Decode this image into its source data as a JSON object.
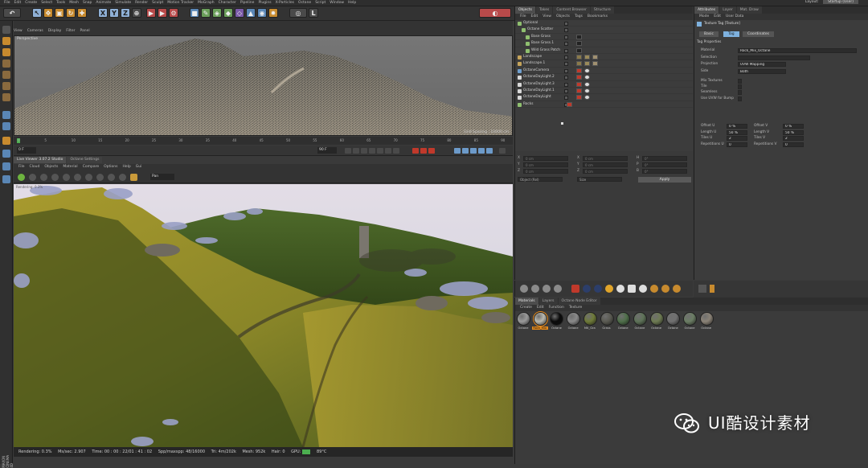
{
  "menubar": {
    "items": [
      "File",
      "Edit",
      "Create",
      "Select",
      "Tools",
      "Mesh",
      "Snap",
      "Animate",
      "Simulate",
      "Render",
      "Sculpt",
      "Motion Tracker",
      "MoGraph",
      "Character",
      "Pipeline",
      "Plugins",
      "X-Particles",
      "Octane",
      "Script",
      "Window",
      "Help"
    ],
    "layout_label": "Layout:",
    "layout_value": "Startup (User)"
  },
  "viewport1": {
    "tabs": [
      "View",
      "Cameras",
      "Display",
      "Filter",
      "Panel"
    ],
    "name": "Perspective",
    "grid_spacing": "Grid Spacing : 10000 cm"
  },
  "timeline": {
    "ticks": [
      "0",
      "5",
      "10",
      "15",
      "20",
      "25",
      "30",
      "35",
      "40",
      "45",
      "50",
      "55",
      "60",
      "65",
      "70",
      "75",
      "80",
      "85",
      "90"
    ],
    "start": "0 F",
    "end": "90 F"
  },
  "viewport2": {
    "tabs": [
      "Live Viewer 3.07.2 Studio",
      "Octane Settings"
    ],
    "menu": [
      "File",
      "Cloud",
      "Objects",
      "Material",
      "Compare",
      "Options",
      "Help",
      "Gui"
    ],
    "zoom": "Pan",
    "render_label": "Rendering: 0.3%"
  },
  "status": {
    "rendering": "Rendering: 0.3%",
    "ms_sec": "Ms/sec: 2.907",
    "time": "Time: 00 : 00 : 22/01 : 41 : 02",
    "spp": "Spp/maxspp: 48/16000",
    "tri": "Tri: 4m/202k",
    "mesh": "Mesh: 952k",
    "hair": "Hair: 0",
    "gpu": "GPU:",
    "temp": "89°C"
  },
  "object_manager": {
    "tabs": [
      "Objects",
      "Takes",
      "Content Browser",
      "Structure"
    ],
    "menu": [
      "File",
      "Edit",
      "View",
      "Objects",
      "Tags",
      "Bookmarks"
    ],
    "objects": [
      {
        "name": "Optional",
        "indent": 0,
        "color": "#8fbf6f"
      },
      {
        "name": "Octane Scatter",
        "indent": 1,
        "color": "#8fbf6f"
      },
      {
        "name": "Base Grass",
        "indent": 2,
        "color": "#8fbf6f"
      },
      {
        "name": "Base Grass.1",
        "indent": 2,
        "color": "#8fbf6f"
      },
      {
        "name": "Wild Grass Patch",
        "indent": 2,
        "color": "#8fbf6f"
      },
      {
        "name": "Landscape",
        "indent": 0,
        "color": "#c4a35a"
      },
      {
        "name": "Landscape.1",
        "indent": 0,
        "color": "#c4a35a"
      },
      {
        "name": "OctaneCamera",
        "indent": 0,
        "color": "#6fa0cf"
      },
      {
        "name": "OctaneDayLight.2",
        "indent": 0,
        "color": "#d8d8d8"
      },
      {
        "name": "OctaneDayLight.3",
        "indent": 0,
        "color": "#d8d8d8"
      },
      {
        "name": "OctaneDayLight.1",
        "indent": 0,
        "color": "#d8d8d8"
      },
      {
        "name": "OctaneDayLight",
        "indent": 0,
        "color": "#d8d8d8"
      },
      {
        "name": "Rocks",
        "indent": 0,
        "color": "#8fbf6f"
      }
    ]
  },
  "coordinates": {
    "rows": [
      [
        "X",
        "0 cm",
        "X",
        "0 cm",
        "H",
        "0°"
      ],
      [
        "Y",
        "0 cm",
        "Y",
        "0 cm",
        "P",
        "0°"
      ],
      [
        "Z",
        "0 cm",
        "Z",
        "0 cm",
        "B",
        "0°"
      ]
    ],
    "mode1": "Object (Rel)",
    "mode2": "Size",
    "apply": "Apply"
  },
  "material_manager": {
    "tabs": [
      "Materials",
      "Layers",
      "Octane Node Editor"
    ],
    "menu": [
      "Create",
      "Edit",
      "Function",
      "Texture"
    ],
    "materials": [
      {
        "name": "Octane",
        "color": "#9a9a9a"
      },
      {
        "name": "Rock_Mix",
        "color": "#b9b9b0"
      },
      {
        "name": "Octane",
        "color": "#0a0a0a"
      },
      {
        "name": "Octane",
        "color": "#8a8a8a"
      },
      {
        "name": "Mtl_Gra",
        "color": "#6e7a38"
      },
      {
        "name": "Grass",
        "color": "#5a5a52"
      },
      {
        "name": "Octane",
        "color": "#4f6f4a"
      },
      {
        "name": "Octane",
        "color": "#5e7258"
      },
      {
        "name": "Octane",
        "color": "#6d7a52"
      },
      {
        "name": "Octane",
        "color": "#707070"
      },
      {
        "name": "Octane",
        "color": "#6b7d64"
      },
      {
        "name": "Octane",
        "color": "#8a8276"
      }
    ]
  },
  "attributes": {
    "tabs": [
      "Attributes",
      "Layer",
      "Mat. Draw"
    ],
    "menu": [
      "Mode",
      "Edit",
      "User Data"
    ],
    "title": "Texture Tag [Texture]",
    "buttons": [
      "Basic",
      "Tag",
      "Coordinates"
    ],
    "section": "Tag Properties",
    "rows": [
      {
        "label": "Material",
        "value": "Rock_Mix_Octane"
      },
      {
        "label": "Selection",
        "value": ""
      },
      {
        "label": "Projection",
        "value": "UVW Mapping"
      },
      {
        "label": "Side",
        "value": "Both"
      },
      {
        "label": "Mix Textures",
        "value": ""
      },
      {
        "label": "Tile",
        "value": ""
      },
      {
        "label": "Seamless",
        "value": ""
      },
      {
        "label": "Use UVW for Bump",
        "value": ""
      }
    ],
    "offsets": [
      {
        "l1": "Offset U",
        "v1": "0 %",
        "l2": "Offset V",
        "v2": "0 %"
      },
      {
        "l1": "Length U",
        "v1": "50 %",
        "l2": "Length V",
        "v2": "50 %"
      },
      {
        "l1": "Tiles U",
        "v1": "2",
        "l2": "Tiles V",
        "v2": "2"
      },
      {
        "l1": "Repetitions U",
        "v1": "0",
        "l2": "Repetitions V",
        "v2": "0"
      }
    ]
  },
  "watermark": "UI酷设计素材",
  "maxon": "MAXON CINEMA 4D"
}
